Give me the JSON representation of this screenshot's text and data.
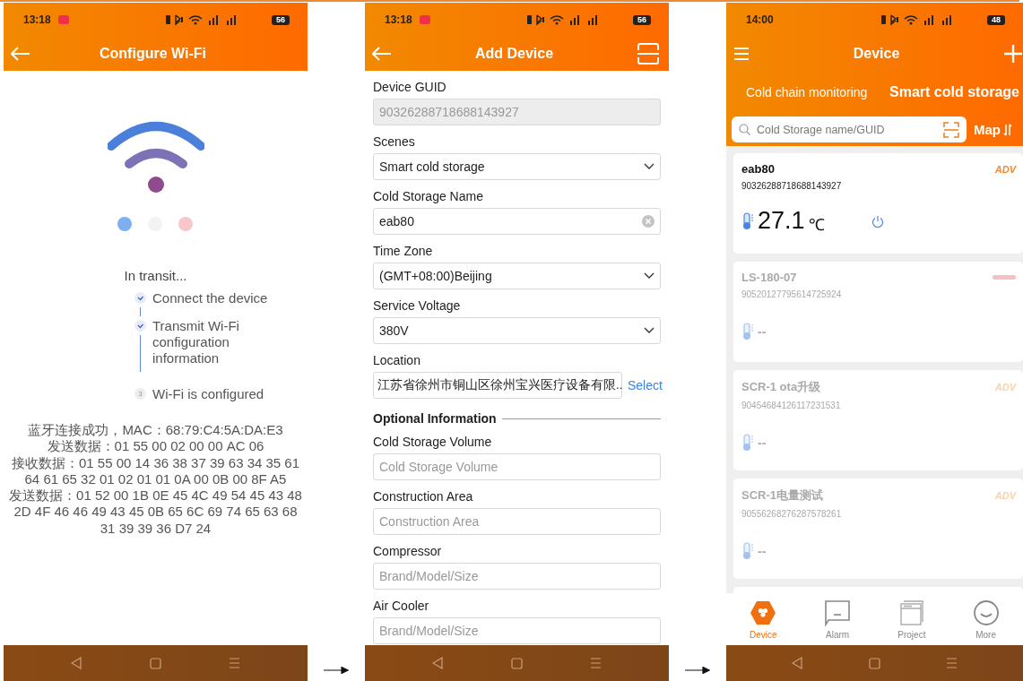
{
  "wifi_screen": {
    "status_bar": {
      "time": "13:18",
      "battery": "56"
    },
    "title": "Configure Wi-Fi",
    "progress_text": "In transit...",
    "steps": [
      {
        "label": "Connect the device",
        "done": true
      },
      {
        "label": "Transmit Wi-Fi configuration information",
        "done": true
      },
      {
        "label": "Wi-Fi is configured",
        "done": false,
        "number": "3"
      }
    ],
    "log": "蓝牙连接成功，MAC：68:79:C4:5A:DA:E3\n发送数据：01 55 00 02 00 00 AC 06\n接收数据：01 55 00 14 36 38 37 39 63 34 35 61 64 61 65 32 01 02 01 01 0A 00 0B 00 8F A5\n发送数据：01 52 00 1B 0E 45 4C 49 54 45 43 48 2D 4F 46 46 49 43 45 0B 65 6C 69 74 65 63 68 31 39 39 36 D7 24"
  },
  "add_device_screen": {
    "status_bar": {
      "time": "13:18",
      "battery": "56"
    },
    "title": "Add Device",
    "fields": [
      {
        "label": "Device GUID",
        "kind": "readonly",
        "value": "90326288718688143927"
      },
      {
        "label": "Scenes",
        "kind": "select",
        "value": "Smart cold storage"
      },
      {
        "label": "Cold Storage Name",
        "kind": "clearable",
        "value": "eab80"
      },
      {
        "label": "Time Zone",
        "kind": "select",
        "value": "(GMT+08:00)Beijing"
      },
      {
        "label": "Service Voltage",
        "kind": "select",
        "value": "380V"
      },
      {
        "label": "Location",
        "kind": "location",
        "value": "江苏省徐州市铜山区徐州宝兴医疗设备有限..",
        "action": "Select"
      },
      {
        "kind": "section",
        "label": "Optional Information"
      },
      {
        "label": "Cold Storage Volume",
        "kind": "text",
        "placeholder": "Cold Storage Volume"
      },
      {
        "label": "Construction Area",
        "kind": "text",
        "placeholder": "Construction Area"
      },
      {
        "label": "Compressor",
        "kind": "text",
        "placeholder": "Brand/Model/Size"
      },
      {
        "label": "Air Cooler",
        "kind": "text",
        "placeholder": "Brand/Model/Size"
      }
    ]
  },
  "device_screen": {
    "status_bar": {
      "time": "14:00",
      "battery": "48"
    },
    "title": "Device",
    "tabs": [
      {
        "label": "Cold chain monitoring",
        "selected": false
      },
      {
        "label": "Smart cold storage",
        "selected": true
      }
    ],
    "search": {
      "placeholder": "Cold Storage name/GUID"
    },
    "map_label": "Map",
    "cards": [
      {
        "name": "eab80",
        "guid": "90326288718688143927",
        "reading": "27.1",
        "unit": "℃",
        "offline": false,
        "status_tag": false,
        "tag": "ADV",
        "power": true
      },
      {
        "name": "LS-180-07",
        "guid": "90520127795614725924",
        "reading": "--",
        "offline": true,
        "status_tag": true,
        "power": false
      },
      {
        "name": "SCR-1 ota升级",
        "guid": "90454684126117231531",
        "reading": "--",
        "offline": true,
        "status_tag": false,
        "tag": "ADV",
        "power": false
      },
      {
        "name": "SCR-1电量测试",
        "guid": "90556268276287578261",
        "reading": "--",
        "offline": true,
        "status_tag": false,
        "tag": "ADV",
        "power": false
      }
    ],
    "bottom_tabs": [
      {
        "label": "Device",
        "selected": true
      },
      {
        "label": "Alarm",
        "selected": false
      },
      {
        "label": "Project",
        "selected": false
      },
      {
        "label": "More",
        "selected": false
      }
    ]
  }
}
